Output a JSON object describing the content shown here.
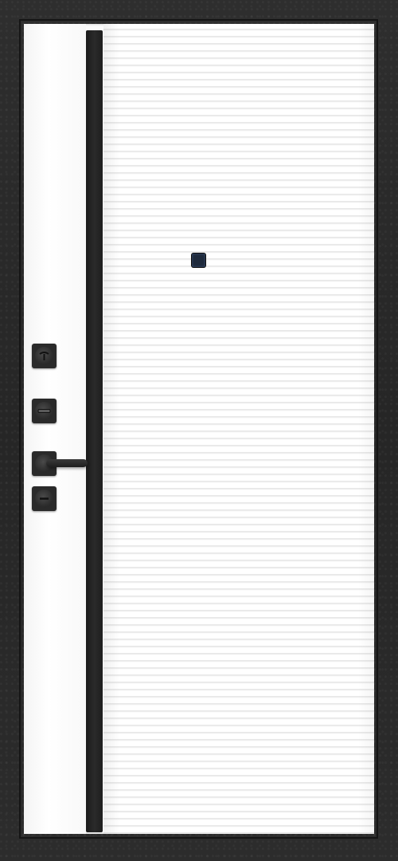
{
  "scene": {
    "subject": "door",
    "colors": {
      "frame": "#2b2b2b",
      "leaf": "#fbfbfb",
      "glass_strip": "#1f1f1f",
      "fittings": "#2a2a2a",
      "peephole": "#1f2a3c"
    },
    "icons": [
      "door-frame",
      "glass-strip",
      "grooved-panel",
      "peephole-icon",
      "cylinder-lock-icon",
      "night-latch-icon",
      "door-handle-icon",
      "lock-cylinder-cover-icon"
    ]
  }
}
